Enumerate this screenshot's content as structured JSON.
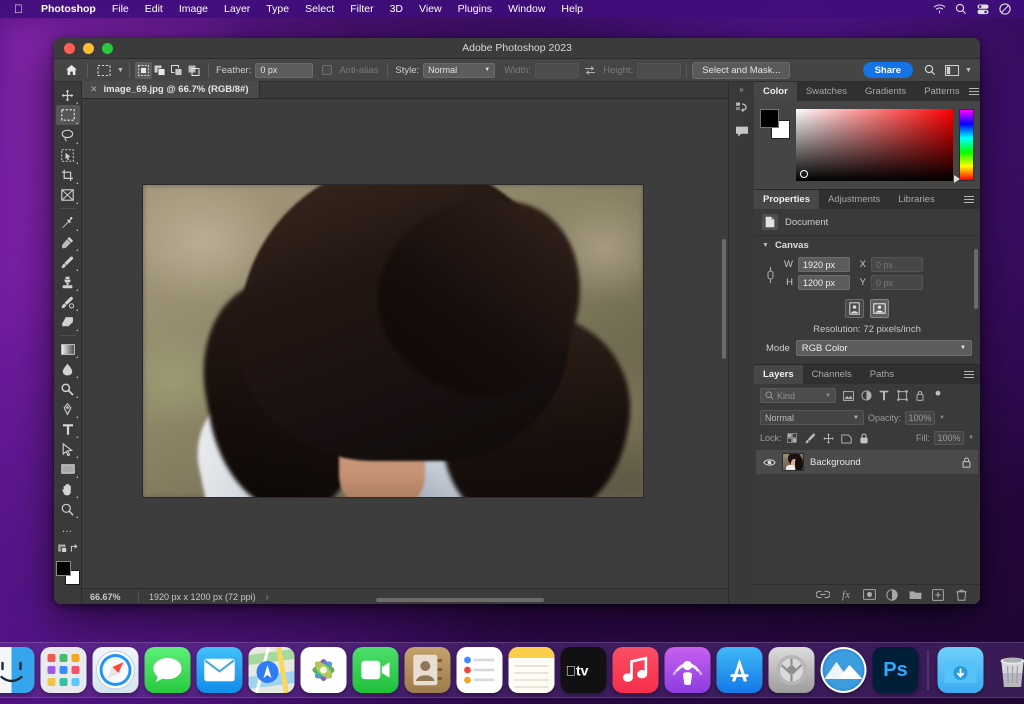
{
  "menubar": {
    "apple_icon": "apple-logo-icon",
    "items": [
      {
        "label": "Photoshop",
        "bold": true
      },
      {
        "label": "File"
      },
      {
        "label": "Edit"
      },
      {
        "label": "Image"
      },
      {
        "label": "Layer"
      },
      {
        "label": "Type"
      },
      {
        "label": "Select"
      },
      {
        "label": "Filter"
      },
      {
        "label": "3D"
      },
      {
        "label": "View"
      },
      {
        "label": "Plugins"
      },
      {
        "label": "Window"
      },
      {
        "label": "Help"
      }
    ],
    "status_icons": [
      "wifi-icon",
      "spotlight-search-icon",
      "control-center-icon",
      "do-not-disturb-icon"
    ],
    "background_color": "#3e0e7c"
  },
  "window": {
    "title": "Adobe Photoshop 2023",
    "traffic_lights": [
      "close",
      "minimize",
      "zoom"
    ]
  },
  "options_bar": {
    "home_icon": "home-icon",
    "active_tool_icon": "rectangular-marquee-icon",
    "selection_modes": [
      "new-selection",
      "add-to-selection",
      "subtract-from-selection",
      "intersect-selection"
    ],
    "feather_label": "Feather:",
    "feather_value": "0 px",
    "antialias_label": "Anti-alias",
    "antialias_checked": false,
    "style_label": "Style:",
    "style_value": "Normal",
    "width_label": "Width:",
    "width_value": "",
    "swap_icon": "swap-dimensions-icon",
    "height_label": "Height:",
    "height_value": "",
    "select_and_mask_label": "Select and Mask...",
    "share_label": "Share",
    "share_color": "#1473e6",
    "search_icon": "search-icon",
    "workspace_icon": "workspace-switcher-icon",
    "chevron_icon": "chevron-down-icon"
  },
  "toolbar": {
    "tools": [
      {
        "name": "move-tool",
        "icon": "move-icon",
        "selected": false
      },
      {
        "name": "rectangular-marquee-tool",
        "icon": "marquee-icon",
        "selected": true
      },
      {
        "name": "lasso-tool",
        "icon": "lasso-icon",
        "selected": false
      },
      {
        "name": "object-selection-tool",
        "icon": "quick-selection-icon",
        "selected": false
      },
      {
        "name": "crop-tool",
        "icon": "crop-icon",
        "selected": false
      },
      {
        "name": "frame-tool",
        "icon": "frame-icon",
        "selected": false
      },
      {
        "name": "eyedropper-tool",
        "icon": "eyedropper-icon",
        "selected": false
      },
      {
        "name": "spot-healing-brush-tool",
        "icon": "healing-brush-icon",
        "selected": false
      },
      {
        "name": "brush-tool",
        "icon": "brush-icon",
        "selected": false
      },
      {
        "name": "clone-stamp-tool",
        "icon": "clone-stamp-icon",
        "selected": false
      },
      {
        "name": "history-brush-tool",
        "icon": "history-brush-icon",
        "selected": false
      },
      {
        "name": "eraser-tool",
        "icon": "eraser-icon",
        "selected": false
      },
      {
        "name": "gradient-tool",
        "icon": "gradient-icon",
        "selected": false
      },
      {
        "name": "blur-tool",
        "icon": "blur-droplet-icon",
        "selected": false
      },
      {
        "name": "dodge-tool",
        "icon": "dodge-icon",
        "selected": false
      },
      {
        "name": "pen-tool",
        "icon": "pen-icon",
        "selected": false
      },
      {
        "name": "type-tool",
        "icon": "type-t-icon",
        "selected": false
      },
      {
        "name": "path-selection-tool",
        "icon": "path-arrow-icon",
        "selected": false
      },
      {
        "name": "rectangle-tool",
        "icon": "rectangle-shape-icon",
        "selected": false
      },
      {
        "name": "hand-tool",
        "icon": "hand-icon",
        "selected": false
      },
      {
        "name": "zoom-tool",
        "icon": "magnifier-icon",
        "selected": false
      },
      {
        "name": "edit-toolbar",
        "icon": "ellipsis-icon",
        "selected": false
      }
    ],
    "quick_mask_icon": "quick-mask-icon",
    "screen_mode_icon": "screen-mode-icon",
    "foreground_color": "#000000",
    "background_color": "#ffffff"
  },
  "document": {
    "tab_label": "image_69.jpg @ 66.7% (RGB/8#)",
    "close_icon": "close-icon"
  },
  "statusbar": {
    "zoom": "66.67%",
    "dimensions": "1920 px x 1200 px (72 ppi)",
    "arrow_icon": "chevron-right-icon"
  },
  "rail": {
    "collapse_icon": "double-chevron-right-icon",
    "buttons": [
      {
        "name": "history-panel-icon"
      },
      {
        "name": "comments-panel-icon"
      }
    ]
  },
  "color_panel": {
    "tabs": [
      {
        "label": "Color",
        "active": true
      },
      {
        "label": "Swatches",
        "active": false
      },
      {
        "label": "Gradients",
        "active": false
      },
      {
        "label": "Patterns",
        "active": false
      }
    ],
    "menu_icon": "panel-menu-icon",
    "foreground_swatch": "#000000",
    "background_swatch": "#ffffff",
    "field_hue": "#ff0000"
  },
  "properties_panel": {
    "tabs": [
      {
        "label": "Properties",
        "active": true
      },
      {
        "label": "Adjustments",
        "active": false
      },
      {
        "label": "Libraries",
        "active": false
      }
    ],
    "menu_icon": "panel-menu-icon",
    "document_label": "Document",
    "document_icon": "document-icon",
    "canvas_section": "Canvas",
    "chevron_icon": "chevron-down-icon",
    "link_icon": "link-dimensions-icon",
    "w_label": "W",
    "w_value": "1920 px",
    "h_label": "H",
    "h_value": "1200 px",
    "x_label": "X",
    "x_placeholder": "0 px",
    "y_label": "Y",
    "y_placeholder": "0 px",
    "portrait_icon": "portrait-orientation-icon",
    "landscape_icon": "landscape-orientation-icon",
    "orientation_active": "landscape",
    "resolution_label": "Resolution: 72 pixels/inch",
    "mode_label": "Mode",
    "mode_value": "RGB Color"
  },
  "layers_panel": {
    "tabs": [
      {
        "label": "Layers",
        "active": true
      },
      {
        "label": "Channels",
        "active": false
      },
      {
        "label": "Paths",
        "active": false
      }
    ],
    "menu_icon": "panel-menu-icon",
    "filter_placeholder": "Kind",
    "filter_search_icon": "search-icon",
    "filter_icons": [
      "filter-pixel-icon",
      "filter-adjustment-icon",
      "filter-type-icon",
      "filter-shape-icon",
      "filter-smart-object-icon",
      "filter-toggle-icon"
    ],
    "blend_mode": "Normal",
    "opacity_label": "Opacity:",
    "opacity_value": "100%",
    "lock_label": "Lock:",
    "lock_icons": [
      "lock-transparent-pixels-icon",
      "lock-image-pixels-icon",
      "lock-position-icon",
      "lock-artboard-icon",
      "lock-all-icon"
    ],
    "fill_label": "Fill:",
    "fill_value": "100%",
    "layers": [
      {
        "name": "Background",
        "visible": true,
        "locked": true,
        "visibility_icon": "eye-icon",
        "lock_icon": "lock-icon"
      }
    ],
    "action_icons": [
      "link-layers-icon",
      "layer-style-fx-icon",
      "add-layer-mask-icon",
      "adjustment-layer-icon",
      "new-group-icon",
      "new-layer-icon",
      "delete-layer-icon"
    ]
  },
  "dock": {
    "apps": [
      {
        "name": "finder",
        "glyph": "",
        "bg": "finder",
        "running": true
      },
      {
        "name": "launchpad",
        "glyph": "",
        "bg": "launchpad",
        "running": false
      },
      {
        "name": "safari",
        "glyph": "",
        "bg": "safari",
        "running": false
      },
      {
        "name": "messages",
        "glyph": "",
        "bg": "messages",
        "running": false
      },
      {
        "name": "mail",
        "glyph": "",
        "bg": "mail",
        "running": false
      },
      {
        "name": "maps",
        "glyph": "",
        "bg": "maps",
        "running": false
      },
      {
        "name": "photos",
        "glyph": "",
        "bg": "photos",
        "running": false
      },
      {
        "name": "facetime",
        "glyph": "",
        "bg": "facetime",
        "running": false
      },
      {
        "name": "contacts",
        "glyph": "",
        "bg": "contacts",
        "running": false
      },
      {
        "name": "reminders",
        "glyph": "",
        "bg": "reminders",
        "running": false
      },
      {
        "name": "notes",
        "glyph": "",
        "bg": "notes",
        "running": false
      },
      {
        "name": "appletv",
        "glyph": "",
        "bg": "appletv",
        "running": false
      },
      {
        "name": "music",
        "glyph": "",
        "bg": "music",
        "running": false
      },
      {
        "name": "podcasts",
        "glyph": "",
        "bg": "podcasts",
        "running": false
      },
      {
        "name": "appstore",
        "glyph": "",
        "bg": "appstore",
        "running": false
      },
      {
        "name": "system-settings",
        "glyph": "",
        "bg": "settings",
        "running": false
      },
      {
        "name": "mountain-app",
        "glyph": "",
        "bg": "mountain",
        "running": false
      },
      {
        "name": "photoshop",
        "glyph": "Ps",
        "bg": "photoshop",
        "running": true
      }
    ],
    "downloads_name": "downloads-folder",
    "trash_name": "trash"
  }
}
